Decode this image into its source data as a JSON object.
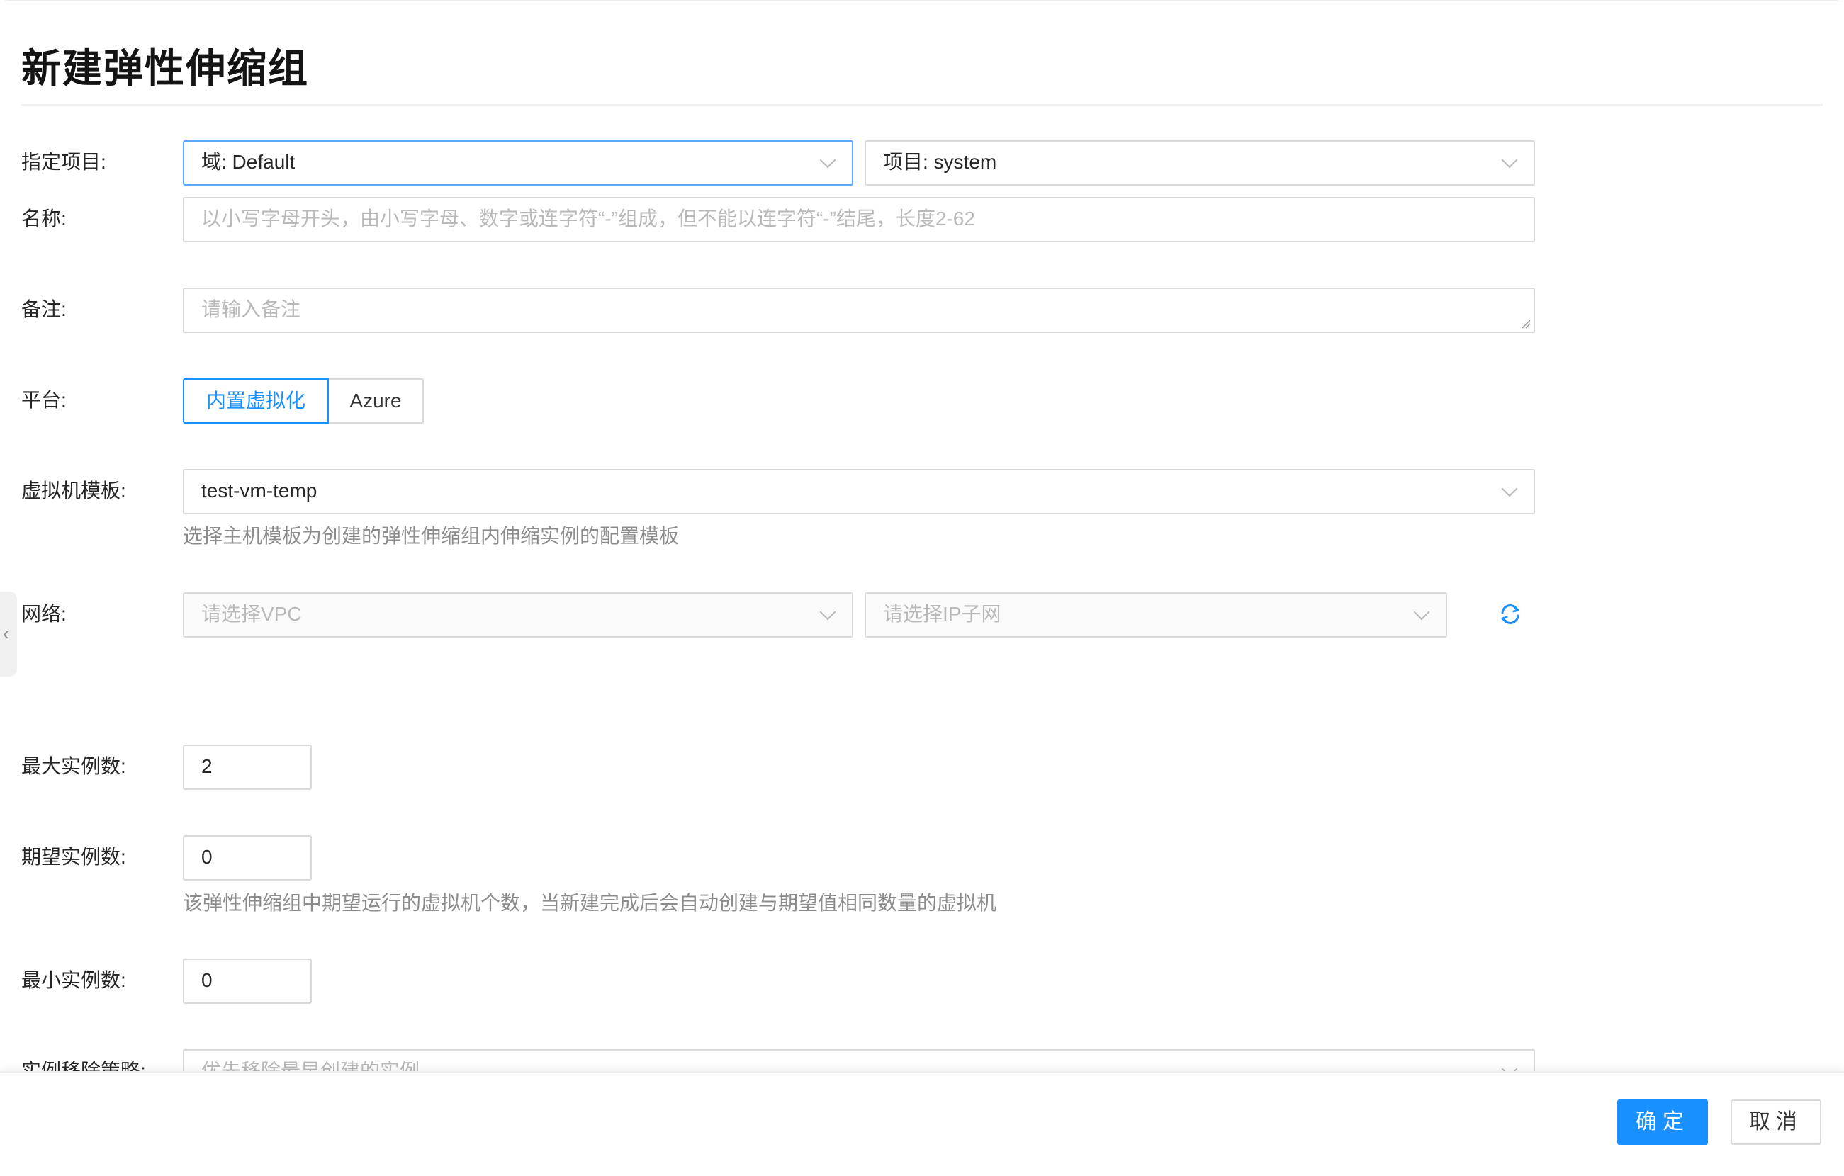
{
  "dialog": {
    "title": "新建弹性伸缩组"
  },
  "form": {
    "project": {
      "label": "指定项目:",
      "domain_value": "域: Default",
      "project_value": "项目: system"
    },
    "name": {
      "label": "名称:",
      "placeholder": "以小写字母开头，由小写字母、数字或连字符“-”组成，但不能以连字符“-”结尾，长度2-62"
    },
    "remark": {
      "label": "备注:",
      "placeholder": "请输入备注"
    },
    "platform": {
      "label": "平台:",
      "options": [
        "内置虚拟化",
        "Azure"
      ],
      "selected": "内置虚拟化"
    },
    "vm_template": {
      "label": "虚拟机模板:",
      "value": "test-vm-temp",
      "help": "选择主机模板为创建的弹性伸缩组内伸缩实例的配置模板"
    },
    "network": {
      "label": "网络:",
      "vpc_placeholder": "请选择VPC",
      "subnet_placeholder": "请选择IP子网"
    },
    "max_instances": {
      "label": "最大实例数:",
      "value": "2"
    },
    "desired_instances": {
      "label": "期望实例数:",
      "value": "0",
      "help": "该弹性伸缩组中期望运行的虚拟机个数，当新建完成后会自动创建与期望值相同数量的虚拟机"
    },
    "min_instances": {
      "label": "最小实例数:",
      "value": "0"
    },
    "removal_policy": {
      "label": "实例移除策略:",
      "value": "优先移除最早创建的实例"
    }
  },
  "footer": {
    "confirm_label": "确定",
    "cancel_label": "取消"
  },
  "colors": {
    "primary": "#1890ff",
    "focus_border": "#5aa9ff",
    "border": "#d9d9d9",
    "help_text": "#8c8c8c",
    "placeholder": "#b9b9b9"
  }
}
